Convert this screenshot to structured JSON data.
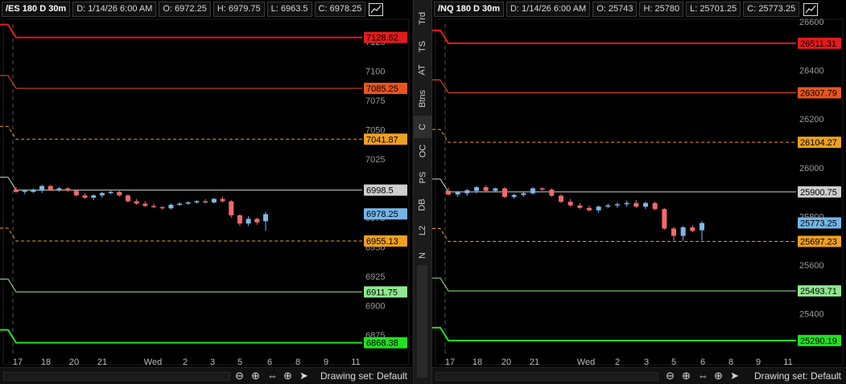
{
  "charts": [
    {
      "symbol": "/ES 180 D 30m",
      "date": "D: 1/14/26 6:00 AM",
      "open": "O: 6972.25",
      "high": "H: 6979.75",
      "low": "L: 6963.5",
      "close": "C: 6978.25",
      "price_min": 6862,
      "price_max": 7140,
      "axis_ticks": [
        "7125",
        "7100",
        "7075",
        "7050",
        "7025",
        "6975",
        "6950",
        "6925",
        "6900",
        "6875"
      ],
      "axis_tick_values": [
        7125,
        7100,
        7075,
        7050,
        7025,
        6975,
        6950,
        6925,
        6900,
        6875
      ],
      "x_labels": [
        "17",
        "18",
        "20",
        "21",
        "Wed",
        "2",
        "3",
        "5",
        "6",
        "8",
        "9",
        "11"
      ],
      "levels": [
        {
          "label": "7128.62",
          "value": 7128.62,
          "color": "#e01c1c",
          "style": "solid",
          "width": 2
        },
        {
          "label": "7085.25",
          "value": 7085.25,
          "color": "#e8551f",
          "style": "solid",
          "width": 1
        },
        {
          "label": "7041.87",
          "value": 7041.87,
          "color": "#f0a020",
          "style": "dash",
          "width": 1
        },
        {
          "label": "6998.5",
          "value": 6998.5,
          "color": "#cfcfcf",
          "style": "solid",
          "width": 1
        },
        {
          "label": "6978.25",
          "value": 6978.25,
          "color": "#74b6e8",
          "style": "none",
          "width": 1
        },
        {
          "label": "6955.13",
          "value": 6955.13,
          "color": "#f0a020",
          "style": "dash",
          "width": 1
        },
        {
          "label": "6911.75",
          "value": 6911.75,
          "color": "#8fe88f",
          "style": "solid",
          "width": 1
        },
        {
          "label": "6868.38",
          "value": 6868.38,
          "color": "#22e022",
          "style": "solid",
          "width": 2
        }
      ],
      "candles": [
        [
          6999,
          7001,
          6996,
          6997
        ],
        [
          6997,
          6999,
          6995,
          6998
        ],
        [
          6997,
          7000,
          6996,
          6999
        ],
        [
          6998,
          7003,
          6996,
          7002
        ],
        [
          7002,
          7003,
          6998,
          6999
        ],
        [
          6999,
          7001,
          6997,
          7000
        ],
        [
          7000,
          7001,
          6997,
          6998
        ],
        [
          6998,
          6999,
          6993,
          6994
        ],
        [
          6994,
          6996,
          6991,
          6992
        ],
        [
          6992,
          6995,
          6990,
          6994
        ],
        [
          6994,
          6997,
          6992,
          6996
        ],
        [
          6996,
          6998,
          6995,
          6997
        ],
        [
          6997,
          6998,
          6993,
          6994
        ],
        [
          6994,
          6995,
          6988,
          6989
        ],
        [
          6989,
          6991,
          6986,
          6987
        ],
        [
          6987,
          6989,
          6984,
          6985
        ],
        [
          6985,
          6987,
          6983,
          6984
        ],
        [
          6984,
          6985,
          6982,
          6983
        ],
        [
          6983,
          6987,
          6982,
          6986
        ],
        [
          6986,
          6988,
          6985,
          6987
        ],
        [
          6987,
          6989,
          6986,
          6988
        ],
        [
          6988,
          6990,
          6987,
          6989
        ],
        [
          6989,
          6991,
          6987,
          6988
        ],
        [
          6988,
          6992,
          6987,
          6991
        ],
        [
          6991,
          6993,
          6988,
          6989
        ],
        [
          6989,
          6990,
          6975,
          6977
        ],
        [
          6977,
          6978,
          6968,
          6970
        ],
        [
          6970,
          6976,
          6968,
          6974
        ],
        [
          6974,
          6975,
          6969,
          6971
        ],
        [
          6972,
          6980,
          6964,
          6978
        ]
      ]
    },
    {
      "symbol": "/NQ 180 D 30m",
      "date": "D: 1/14/26 6:00 AM",
      "open": "O: 25743",
      "high": "H: 25780",
      "low": "L: 25701.25",
      "close": "C: 25773.25",
      "price_min": 25250,
      "price_max": 26590,
      "axis_ticks": [
        "26600",
        "26400",
        "26200",
        "26000",
        "25800",
        "25600",
        "25400"
      ],
      "axis_tick_values": [
        26600,
        26400,
        26200,
        26000,
        25800,
        25600,
        25400
      ],
      "x_labels": [
        "17",
        "18",
        "20",
        "21",
        "Wed",
        "2",
        "3",
        "5",
        "6",
        "8",
        "9",
        "11"
      ],
      "levels": [
        {
          "label": "26511.31",
          "value": 26511.31,
          "color": "#e01c1c",
          "style": "solid",
          "width": 2
        },
        {
          "label": "26307.79",
          "value": 26307.79,
          "color": "#e8551f",
          "style": "solid",
          "width": 1
        },
        {
          "label": "26104.27",
          "value": 26104.27,
          "color": "#f0a020",
          "style": "dash",
          "width": 1
        },
        {
          "label": "25900.75",
          "value": 25900.75,
          "color": "#cfcfcf",
          "style": "solid",
          "width": 1
        },
        {
          "label": "25773.25",
          "value": 25773.25,
          "color": "#74b6e8",
          "style": "none",
          "width": 1
        },
        {
          "label": "25697.23",
          "value": 25697.23,
          "color": "#f0a020",
          "style": "dash",
          "width": 1
        },
        {
          "label": "25493.71",
          "value": 25493.71,
          "color": "#8fe88f",
          "style": "solid",
          "width": 1
        },
        {
          "label": "25290.19",
          "value": 25290.19,
          "color": "#22e022",
          "style": "solid",
          "width": 2
        }
      ],
      "candles": [
        [
          25905,
          25918,
          25885,
          25890
        ],
        [
          25890,
          25905,
          25880,
          25900
        ],
        [
          25895,
          25912,
          25885,
          25908
        ],
        [
          25905,
          25925,
          25895,
          25920
        ],
        [
          25920,
          25928,
          25900,
          25905
        ],
        [
          25905,
          25918,
          25900,
          25915
        ],
        [
          25915,
          25920,
          25875,
          25880
        ],
        [
          25880,
          25893,
          25872,
          25888
        ],
        [
          25888,
          25900,
          25880,
          25895
        ],
        [
          25895,
          25920,
          25890,
          25915
        ],
        [
          25915,
          25920,
          25905,
          25910
        ],
        [
          25910,
          25915,
          25880,
          25885
        ],
        [
          25885,
          25890,
          25855,
          25860
        ],
        [
          25860,
          25872,
          25840,
          25845
        ],
        [
          25845,
          25855,
          25830,
          25835
        ],
        [
          25835,
          25845,
          25820,
          25825
        ],
        [
          25825,
          25845,
          25815,
          25840
        ],
        [
          25840,
          25852,
          25835,
          25845
        ],
        [
          25845,
          25858,
          25835,
          25850
        ],
        [
          25850,
          25865,
          25840,
          25855
        ],
        [
          25855,
          25868,
          25835,
          25840
        ],
        [
          25840,
          25860,
          25830,
          25855
        ],
        [
          25855,
          25860,
          25825,
          25830
        ],
        [
          25830,
          25835,
          25745,
          25750
        ],
        [
          25750,
          25758,
          25700,
          25720
        ],
        [
          25720,
          25760,
          25700,
          25755
        ],
        [
          25755,
          25765,
          25735,
          25740
        ],
        [
          25743,
          25780,
          25701,
          25773
        ]
      ]
    }
  ],
  "side_tabs": [
    "Trd",
    "TS",
    "AT",
    "Btns",
    "C",
    "OC",
    "PS",
    "DB",
    "L2",
    "N"
  ],
  "drawing_set": "Drawing set: Default"
}
